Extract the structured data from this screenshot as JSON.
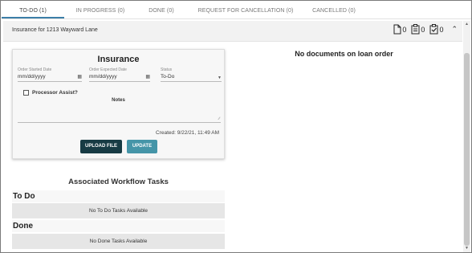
{
  "tabs": [
    {
      "label": "TO-DO (1)",
      "active": true
    },
    {
      "label": "IN PROGRESS (0)",
      "active": false
    },
    {
      "label": "DONE (0)",
      "active": false
    },
    {
      "label": "REQUEST FOR CANCELLATION (0)",
      "active": false
    },
    {
      "label": "CANCELLED (0)",
      "active": false
    }
  ],
  "loan": {
    "title": "Insurance for 1213 Wayward Lane",
    "doc_counts": [
      {
        "icon": "document-icon",
        "count": "0"
      },
      {
        "icon": "clipboard-list-icon",
        "count": "0"
      },
      {
        "icon": "clipboard-check-icon",
        "count": "0"
      }
    ],
    "collapse_icon": "chevron-up-icon"
  },
  "order_card": {
    "title": "Insurance",
    "order_started": {
      "label": "Order Started Date",
      "value": "mm/dd/yyyy"
    },
    "order_expected": {
      "label": "Order Expected Date",
      "value": "mm/dd/yyyy"
    },
    "status": {
      "label": "Status",
      "value": "To-Do"
    },
    "processor_assist": {
      "label": "Processor Assist?",
      "checked": false
    },
    "notes_label": "Notes",
    "notes_value": "",
    "created": "Created: 9/22/21, 11:49 AM",
    "upload_label": "UPLOAD FILE",
    "update_label": "UPDATE"
  },
  "documents": {
    "empty_message": "No documents on loan order"
  },
  "workflow": {
    "title": "Associated Workflow Tasks",
    "todo_label": "To Do",
    "todo_empty": "No To Do Tasks Available",
    "done_label": "Done",
    "done_empty": "No Done Tasks Available"
  },
  "colors": {
    "active_tab_underline": "#3c7fa8",
    "upload_button": "#173b44",
    "update_button": "#4595a8"
  }
}
